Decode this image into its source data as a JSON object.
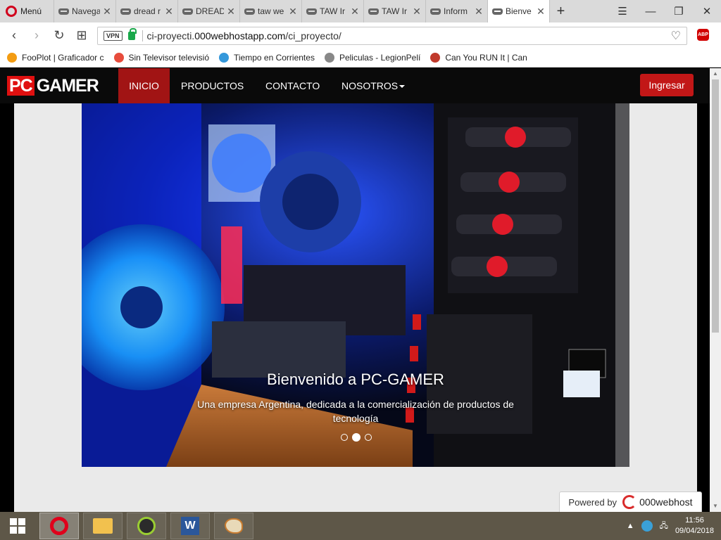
{
  "browser": {
    "menu_label": "Menú",
    "tabs": [
      {
        "label": "Navega"
      },
      {
        "label": "dread r"
      },
      {
        "label": "DREAD"
      },
      {
        "label": "taw we"
      },
      {
        "label": "TAW Ir"
      },
      {
        "label": "TAW Ir"
      },
      {
        "label": "Inform"
      },
      {
        "label": "Bienve",
        "active": true
      }
    ],
    "new_tab_symbol": "+",
    "url_prefix": "ci-proyecti.",
    "url_host": "000webhostapp.com",
    "url_path": "/ci_proyecto/",
    "vpn_label": "VPN",
    "abp_label": "ABP",
    "bookmarks": [
      {
        "label": "FooPlot | Graficador c",
        "icon": "fooplot-icon",
        "color": "#f39c12"
      },
      {
        "label": "Sin Televisor televisió",
        "icon": "tv-icon",
        "color": "#e74c3c"
      },
      {
        "label": "Tiempo en Corrientes",
        "icon": "weather-icon",
        "color": "#3498db"
      },
      {
        "label": "Peliculas - LegionPelí",
        "icon": "film-icon",
        "color": "#888888"
      },
      {
        "label": "Can You RUN It | Can",
        "icon": "canyourunit-icon",
        "color": "#c0392b"
      }
    ]
  },
  "site": {
    "logo_pc": "PC",
    "logo_gamer": "GAMER",
    "nav": {
      "inicio": "INICIO",
      "productos": "PRODUCTOS",
      "contacto": "CONTACTO",
      "nosotros": "NOSOTROS"
    },
    "login_label": "Ingresar",
    "carousel": {
      "title": "Bienvenido a PC-GAMER",
      "subtitle": "Una empresa Argentina, dedicada a la comercialización de productos de tecnología",
      "slides": 3,
      "active_slide": 2
    },
    "powered_label": "Powered by",
    "powered_brand": "000webhost"
  },
  "taskbar": {
    "time": "11:56",
    "date": "09/04/2018",
    "apps": [
      "opera-icon",
      "file-explorer-icon",
      "geogebra-icon",
      "word-icon",
      "paint-icon"
    ]
  },
  "colors": {
    "brand_red": "#c21717",
    "nav_active": "#a11414"
  }
}
